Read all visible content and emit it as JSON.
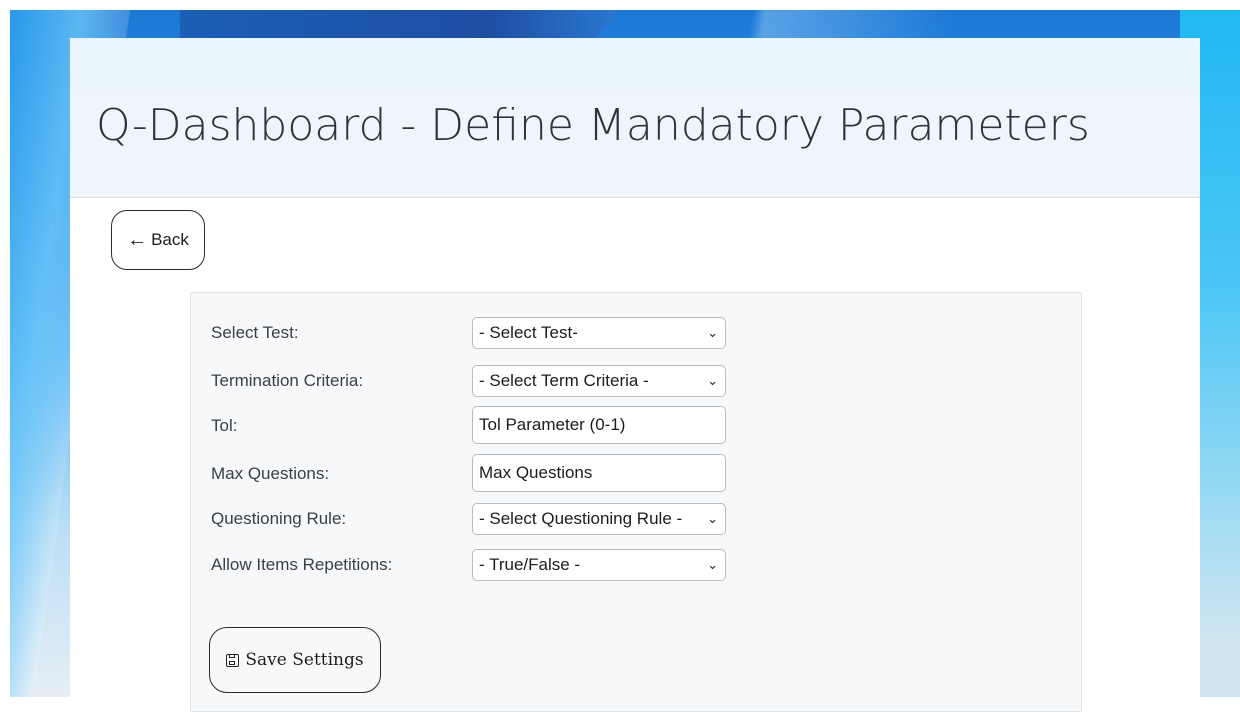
{
  "header": {
    "title": "Q-Dashboard - Define Mandatory Parameters"
  },
  "nav": {
    "back_label": "Back",
    "back_icon": "left-arrow-icon"
  },
  "form": {
    "fields": [
      {
        "label": "Select Test:",
        "type": "select",
        "value": "- Select Test-"
      },
      {
        "label": "Termination Criteria:",
        "type": "select",
        "value": "- Select Term Criteria -"
      },
      {
        "label": "Tol:",
        "type": "input",
        "placeholder": "Tol Parameter (0-1)"
      },
      {
        "label": "Max Questions:",
        "type": "input",
        "placeholder": "Max Questions"
      },
      {
        "label": "Questioning Rule:",
        "type": "select",
        "value": "- Select Questioning Rule -"
      },
      {
        "label": "Allow Items Repetitions:",
        "type": "select",
        "value": "- True/False -"
      }
    ],
    "save_label": "Save Settings",
    "save_icon": "floppy-disk-icon"
  }
}
